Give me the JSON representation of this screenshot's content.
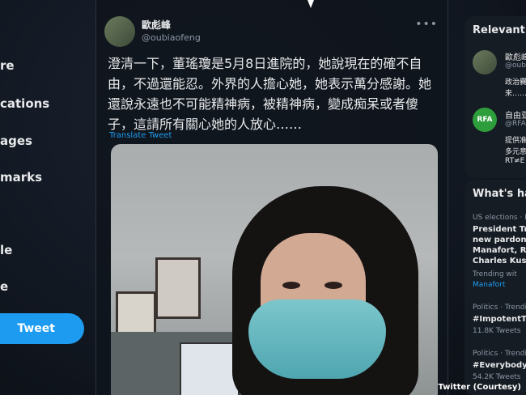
{
  "nav": {
    "items": [
      {
        "label": "re"
      },
      {
        "label": "cations"
      },
      {
        "label": "ages"
      },
      {
        "label": "marks"
      },
      {
        "label": "le"
      },
      {
        "label": "e"
      }
    ],
    "tweet_button": "Tweet"
  },
  "tweet": {
    "name": "歐彪峰",
    "handle": "@oubiaofeng",
    "more": "•••",
    "text": "澄清一下，董瑤瓊是5月8日進院的，她說現在的確不自由，不過還能忍。外界的人擔心她，她表示萬分感謝。她還說永遠也不可能精神病，被精神病，變成痴呆或者傻子，這請所有關心她的人放心……",
    "translate_label": "Translate Tweet"
  },
  "sidebar": {
    "relevant_title": "Relevant p",
    "people": [
      {
        "name": "歐彪峰",
        "handle": "@oubi",
        "bio_line1": "政治爨",
        "bio_line2": "来……"
      },
      {
        "avatar_text": "RFA",
        "name": "自由亚",
        "handle": "@RFA",
        "bio_line1": "提供准",
        "bio_line2": "多元意",
        "bio_line3": "RT≠E"
      }
    ],
    "trends_title": "What's hap",
    "trends": [
      {
        "context": "US elections · L",
        "lines": [
          "President Tru",
          "new pardons",
          "Manafort, Rog",
          "Charles Kushn"
        ],
        "trending_label": "Trending wit",
        "link": "Manafort"
      },
      {
        "context": "Politics · Trendin",
        "tag": "#ImpotentTru",
        "count": "11.8K Tweets"
      },
      {
        "context": "Politics · Trendin",
        "tag": "#EverybodyIsT",
        "count": "54.2K Tweets"
      }
    ]
  },
  "credit": "Twitter (Courtesy)",
  "colors": {
    "accent": "#1d9bf0",
    "background": "#121822",
    "rfa_green": "#2e9e3c"
  }
}
